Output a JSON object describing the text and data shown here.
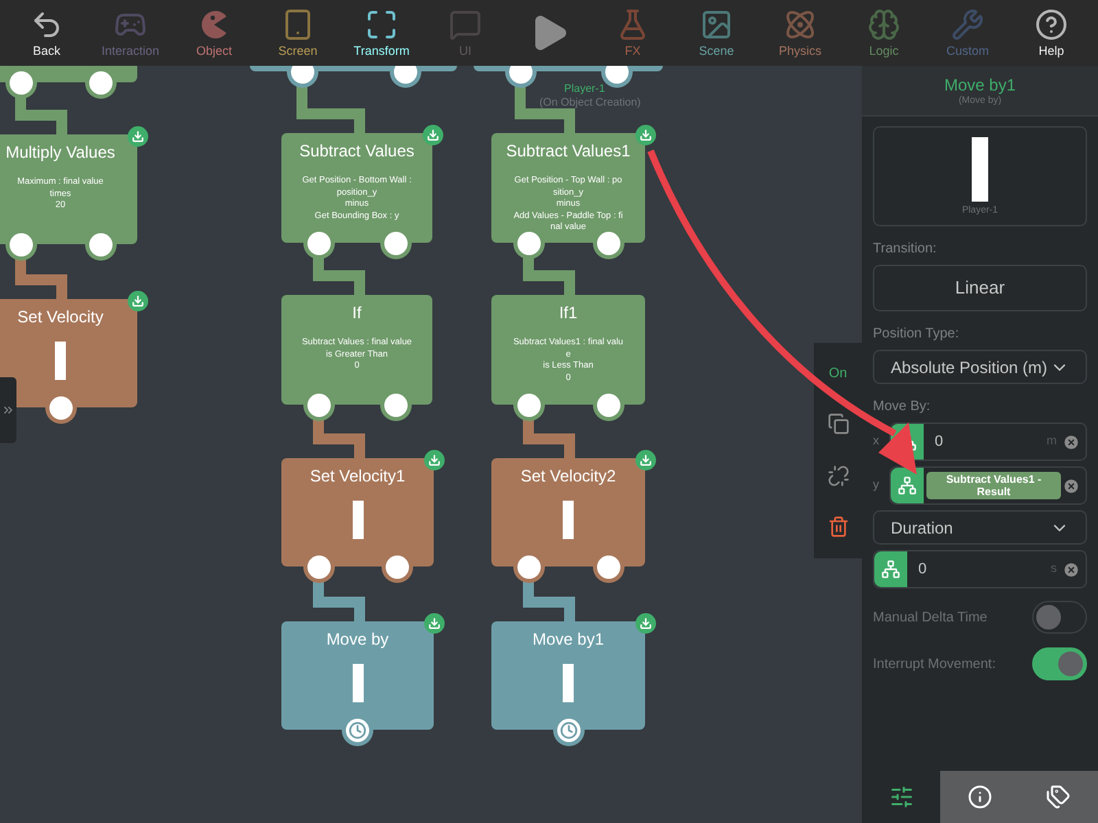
{
  "toolbar": [
    {
      "kind": "back",
      "label": "Back",
      "color": "#b5b5b5"
    },
    {
      "kind": "gamepad",
      "label": "Interaction",
      "color": "#4f4a60"
    },
    {
      "kind": "pacman",
      "label": "Object",
      "color": "#8f5555"
    },
    {
      "kind": "tablet",
      "label": "Screen",
      "color": "#8a7440"
    },
    {
      "kind": "expand",
      "label": "Transform",
      "color": "#6fc0cf"
    },
    {
      "kind": "chat",
      "label": "UI",
      "color": "#4a4446"
    },
    {
      "kind": "play",
      "color": "#8a8a8a"
    },
    {
      "kind": "flask",
      "label": "FX",
      "color": "#7a4636"
    },
    {
      "kind": "image",
      "label": "Scene",
      "color": "#4d7878"
    },
    {
      "kind": "atom",
      "label": "Physics",
      "color": "#7a5646"
    },
    {
      "kind": "brain",
      "label": "Logic",
      "color": "#4a6848"
    },
    {
      "kind": "wrench",
      "label": "Custom",
      "color": "#3d4c66"
    },
    {
      "kind": "help",
      "label": "Help",
      "color": "#b5b5b5"
    }
  ],
  "nodes": [
    {
      "kind": "stub",
      "color": "#6f9a6a",
      "ports": [
        {
          "kind": "circle"
        },
        {
          "kind": "circle"
        }
      ]
    },
    {
      "kind": "text",
      "color": "#6f9a6a",
      "title": "Multiply Values",
      "body": "Maximum : final value\ntimes\n20",
      "badge": true,
      "linked": true,
      "ports": [
        {
          "kind": "circle"
        },
        {
          "kind": "circle"
        }
      ]
    },
    {
      "kind": "sprite",
      "color": "#a8775a",
      "title": "Set Velocity",
      "badge": true,
      "linked": true,
      "ports": [
        {
          "kind": "circle"
        }
      ]
    },
    {
      "kind": "stub",
      "color": "#6d9ea8",
      "ports": [
        {
          "kind": "circle"
        },
        {
          "kind": "circle"
        }
      ]
    },
    {
      "kind": "text",
      "color": "#6f9a6a",
      "title": "Subtract Values",
      "body": "Get Position - Bottom Wall :\nposition_y\nminus\nGet Bounding Box : y",
      "badge": true,
      "linked": true,
      "ports": [
        {
          "kind": "circle"
        },
        {
          "kind": "circle"
        }
      ]
    },
    {
      "kind": "text",
      "color": "#6f9a6a",
      "title": "If",
      "body": "Subtract Values : final value\nis Greater Than\n0",
      "badge": false,
      "linked": true,
      "ports": [
        {
          "kind": "circle"
        },
        {
          "kind": "circle"
        }
      ]
    },
    {
      "kind": "sprite",
      "color": "#a8775a",
      "title": "Set Velocity1",
      "badge": true,
      "linked": true,
      "ports": [
        {
          "kind": "circle"
        },
        {
          "kind": "circle"
        }
      ]
    },
    {
      "kind": "sprite",
      "color": "#6d9ea8",
      "title": "Move by",
      "badge": true,
      "linked": true,
      "ports": [
        {
          "kind": "clock"
        }
      ]
    },
    {
      "kind": "stub",
      "color": "#6d9ea8",
      "caption": "Player-1",
      "subcaption": "(On Object Creation)",
      "ports": [
        {
          "kind": "circle"
        },
        {
          "kind": "circle"
        }
      ]
    },
    {
      "kind": "text",
      "color": "#6f9a6a",
      "title": "Subtract Values1",
      "body": "Get Position - Top Wall : po\nsition_y\nminus\nAdd Values - Paddle Top : fi\nnal value",
      "badge": true,
      "linked": true,
      "ports": [
        {
          "kind": "circle"
        },
        {
          "kind": "circle"
        }
      ]
    },
    {
      "kind": "text",
      "color": "#6f9a6a",
      "title": "If1",
      "body": "Subtract Values1 : final valu\ne\nis Less Than\n0",
      "badge": false,
      "linked": true,
      "ports": [
        {
          "kind": "circle"
        },
        {
          "kind": "circle"
        }
      ]
    },
    {
      "kind": "sprite",
      "color": "#a8775a",
      "title": "Set Velocity2",
      "badge": true,
      "linked": true,
      "ports": [
        {
          "kind": "circle"
        },
        {
          "kind": "circle"
        }
      ]
    },
    {
      "kind": "sprite",
      "color": "#6d9ea8",
      "title": "Move by1",
      "badge": true,
      "linked": true,
      "ports": [
        {
          "kind": "clock"
        }
      ]
    }
  ],
  "side_tools": [
    {
      "kind": "toggle",
      "label": "On"
    },
    {
      "kind": "copy"
    },
    {
      "kind": "unlink"
    },
    {
      "kind": "delete"
    }
  ],
  "annotation": {
    "kind": "arrow",
    "color": "#e8414a"
  },
  "panel": {
    "title": "Move by1",
    "subtitle": "(Move by)",
    "preview_caption": "Player-1",
    "fields": [
      {
        "kind": "label",
        "text": "Transition:"
      },
      {
        "kind": "button",
        "text": "Linear"
      },
      {
        "kind": "label",
        "text": "Position Type:"
      },
      {
        "kind": "dropdown",
        "text": "Absolute Position (m)"
      },
      {
        "kind": "label",
        "text": "Move By:"
      },
      {
        "kind": "input",
        "axis": "x",
        "value": "0",
        "unit": "m"
      },
      {
        "kind": "chip",
        "axis": "y",
        "text": "Subtract Values1 - Result"
      },
      {
        "kind": "dropdown",
        "text": "Duration"
      },
      {
        "kind": "input",
        "value": "0",
        "unit": "s"
      },
      {
        "kind": "toggle",
        "text": "Manual Delta Time",
        "on": false
      },
      {
        "kind": "toggle",
        "text": "Interrupt Movement:",
        "on": true
      }
    ],
    "tabs": [
      {
        "kind": "settings",
        "selected": true
      },
      {
        "kind": "info",
        "selected": false
      },
      {
        "kind": "tags",
        "selected": false
      }
    ]
  }
}
